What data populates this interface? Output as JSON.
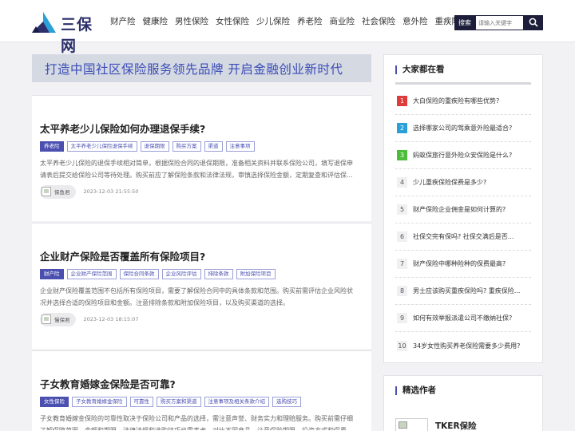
{
  "header": {
    "logo_text": "三保网",
    "nav": [
      "财产险",
      "健康险",
      "男性保险",
      "女性保险",
      "少儿保险",
      "养老险",
      "商业险",
      "社会保险",
      "意外险",
      "重疾险"
    ],
    "search_label": "搜索",
    "search_placeholder": "请输入关键字"
  },
  "banner": {
    "text": "打造中国社区保险服务领先品牌    开启金融创业新时代"
  },
  "articles": [
    {
      "title": "太平养老少儿保险如何办理退保手续?",
      "tags": [
        "养老险",
        "太平养老少儿保险退保手续",
        "退保期限",
        "购买方案",
        "渠道",
        "注意事项"
      ],
      "desc": "太平养老少儿保险的退保手续相对简单，根据保险合同的退保期限，准备相关资料并联系保险公司，填写退保申请表后提交给保险公司等待处理。购买前应了解保险条款和法律法规，审慎选择保险金额，定期复查和评估保...",
      "author": "保鱼君",
      "time": "2023-12-03 21:55:50"
    },
    {
      "title": "企业财产保险是否覆盖所有保险项目?",
      "tags": [
        "财产险",
        "企业财产保险范围",
        "保险合同条款",
        "企业风险评估",
        "排除条款",
        "附加保险项目"
      ],
      "desc": "企业财产保险覆盖范围不包括所有保险项目，需要了解保险合同中的具体条款和范围。购买前需评估企业风险状况并选择合适的保险项目和金额。注意排除条款和附加保险项目，以及购买渠道的选择。",
      "author": "慢保君",
      "time": "2023-12-03 18:15:07"
    },
    {
      "title": "子女教育婚嫁金保险是否可靠?",
      "tags": [
        "女性保险",
        "子女教育婚嫁金保险",
        "可靠性",
        "购买方案和渠道",
        "注意事项及相关条款介绍",
        "选购技巧"
      ],
      "desc": "子女教育婚嫁金保险的可靠性取决于保险公司和产品的选择，需注意声誉、财务实力和理赔服务。购买前需仔细了解保障范围、金额和期限，法律法规和选购技巧也需考虑。对比不同产品，注意保险期限、投资方式和保费...",
      "author": "",
      "time": ""
    }
  ],
  "sidebar": {
    "hot_title": "大家都在看",
    "hot": [
      {
        "num": "1",
        "text": "大白保险的重疾险有哪些优势?"
      },
      {
        "num": "2",
        "text": "选择哪家公司的驾乘意外险最适合?"
      },
      {
        "num": "3",
        "text": "蚂蚁保旅行意外险众安保险是什么?"
      },
      {
        "num": "4",
        "text": "少儿重疾保险保费是多少?"
      },
      {
        "num": "5",
        "text": "财产保险企业佣金是如何计算的?"
      },
      {
        "num": "6",
        "text": "社保交完有保吗? 社保交满后是否..."
      },
      {
        "num": "7",
        "text": "财产保险中哪种险种的保费最高?"
      },
      {
        "num": "8",
        "text": "男士应该购买重疾保险吗? 重疾保险..."
      },
      {
        "num": "9",
        "text": "如何有效举报派遣公司不缴纳社保?"
      },
      {
        "num": "10",
        "text": "34岁女性购买养老保险需要多少费用?"
      }
    ],
    "writers_title": "精选作者",
    "writer_name": "TKER保险"
  }
}
